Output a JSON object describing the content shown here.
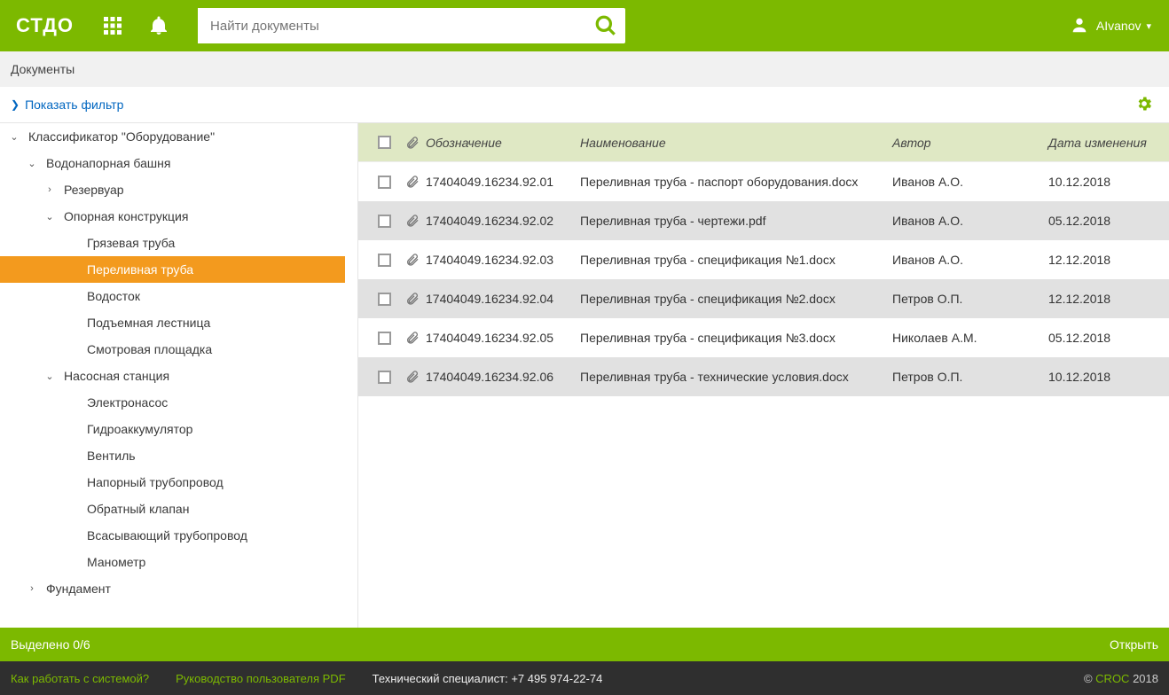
{
  "header": {
    "logo": "СТДО",
    "search_placeholder": "Найти документы",
    "user_name": "AIvanov"
  },
  "breadcrumb": {
    "title": "Документы"
  },
  "filter": {
    "show_label": "Показать фильтр"
  },
  "tree": [
    {
      "label": "Классификатор \"Оборудование\"",
      "level": 0,
      "toggle": "down",
      "selected": false
    },
    {
      "label": "Водонапорная башня",
      "level": 1,
      "toggle": "down",
      "selected": false
    },
    {
      "label": "Резервуар",
      "level": 2,
      "toggle": "right",
      "selected": false
    },
    {
      "label": "Опорная конструкция",
      "level": 2,
      "toggle": "down",
      "selected": false
    },
    {
      "label": "Грязевая труба",
      "level": 3,
      "toggle": "",
      "selected": false
    },
    {
      "label": "Переливная труба",
      "level": 3,
      "toggle": "",
      "selected": true
    },
    {
      "label": "Водосток",
      "level": 3,
      "toggle": "",
      "selected": false
    },
    {
      "label": "Подъемная лестница",
      "level": 3,
      "toggle": "",
      "selected": false
    },
    {
      "label": "Смотровая площадка",
      "level": 3,
      "toggle": "",
      "selected": false
    },
    {
      "label": "Насосная станция",
      "level": 2,
      "toggle": "down",
      "selected": false
    },
    {
      "label": "Электронасос",
      "level": 3,
      "toggle": "",
      "selected": false
    },
    {
      "label": "Гидроаккумулятор",
      "level": 3,
      "toggle": "",
      "selected": false
    },
    {
      "label": "Вентиль",
      "level": 3,
      "toggle": "",
      "selected": false
    },
    {
      "label": "Напорный трубопровод",
      "level": 3,
      "toggle": "",
      "selected": false
    },
    {
      "label": "Обратный клапан",
      "level": 3,
      "toggle": "",
      "selected": false
    },
    {
      "label": "Всасывающий трубопровод",
      "level": 3,
      "toggle": "",
      "selected": false
    },
    {
      "label": "Манометр",
      "level": 3,
      "toggle": "",
      "selected": false
    },
    {
      "label": "Фундамент",
      "level": 1,
      "toggle": "right",
      "selected": false
    }
  ],
  "table": {
    "headers": {
      "code": "Обозначение",
      "name": "Наименование",
      "author": "Автор",
      "date": "Дата изменения"
    },
    "rows": [
      {
        "code": "17404049.16234.92.01",
        "name": "Переливная труба - паспорт оборудования.docx",
        "author": "Иванов А.О.",
        "date": "10.12.2018"
      },
      {
        "code": "17404049.16234.92.02",
        "name": "Переливная труба - чертежи.pdf",
        "author": "Иванов А.О.",
        "date": "05.12.2018"
      },
      {
        "code": "17404049.16234.92.03",
        "name": "Переливная труба - спецификация №1.docx",
        "author": "Иванов А.О.",
        "date": "12.12.2018"
      },
      {
        "code": "17404049.16234.92.04",
        "name": "Переливная труба - спецификация №2.docx",
        "author": "Петров О.П.",
        "date": "12.12.2018"
      },
      {
        "code": "17404049.16234.92.05",
        "name": "Переливная труба - спецификация №3.docx",
        "author": "Николаев А.М.",
        "date": "05.12.2018"
      },
      {
        "code": "17404049.16234.92.06",
        "name": "Переливная труба - технические условия.docx",
        "author": "Петров О.П.",
        "date": "10.12.2018"
      }
    ]
  },
  "status": {
    "selection_text": "Выделено 0/6",
    "open_label": "Открыть"
  },
  "footer": {
    "help_link": "Как работать с системой?",
    "manual_link": "Руководство пользователя PDF",
    "tech_label": "Технический специалист:",
    "tech_phone": "+7 495 974-22-74",
    "copyright_prefix": "© ",
    "copyright_brand": "CROC",
    "copyright_year": " 2018"
  }
}
